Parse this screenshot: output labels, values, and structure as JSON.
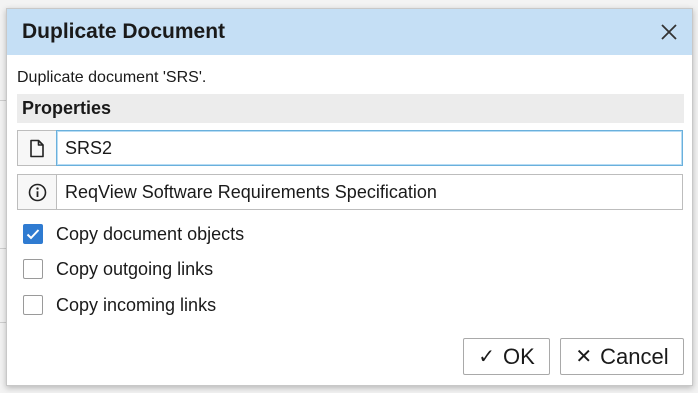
{
  "dialog": {
    "title": "Duplicate Document",
    "description": "Duplicate document 'SRS'.",
    "section_title": "Properties",
    "fields": {
      "document_id": {
        "value": "SRS2",
        "icon": "document-icon"
      },
      "document_name": {
        "value": "ReqView Software Requirements Specification",
        "icon": "info-icon"
      }
    },
    "options": [
      {
        "label": "Copy document objects",
        "checked": true
      },
      {
        "label": "Copy outgoing links",
        "checked": false
      },
      {
        "label": "Copy incoming links",
        "checked": false
      }
    ],
    "buttons": {
      "ok_glyph": "✓",
      "ok_label": "OK",
      "cancel_glyph": "✕",
      "cancel_label": "Cancel"
    }
  },
  "colors": {
    "titlebar": "#c5dff5",
    "checkbox_checked": "#2f7bd1",
    "focus_border": "#6ab0dc"
  }
}
